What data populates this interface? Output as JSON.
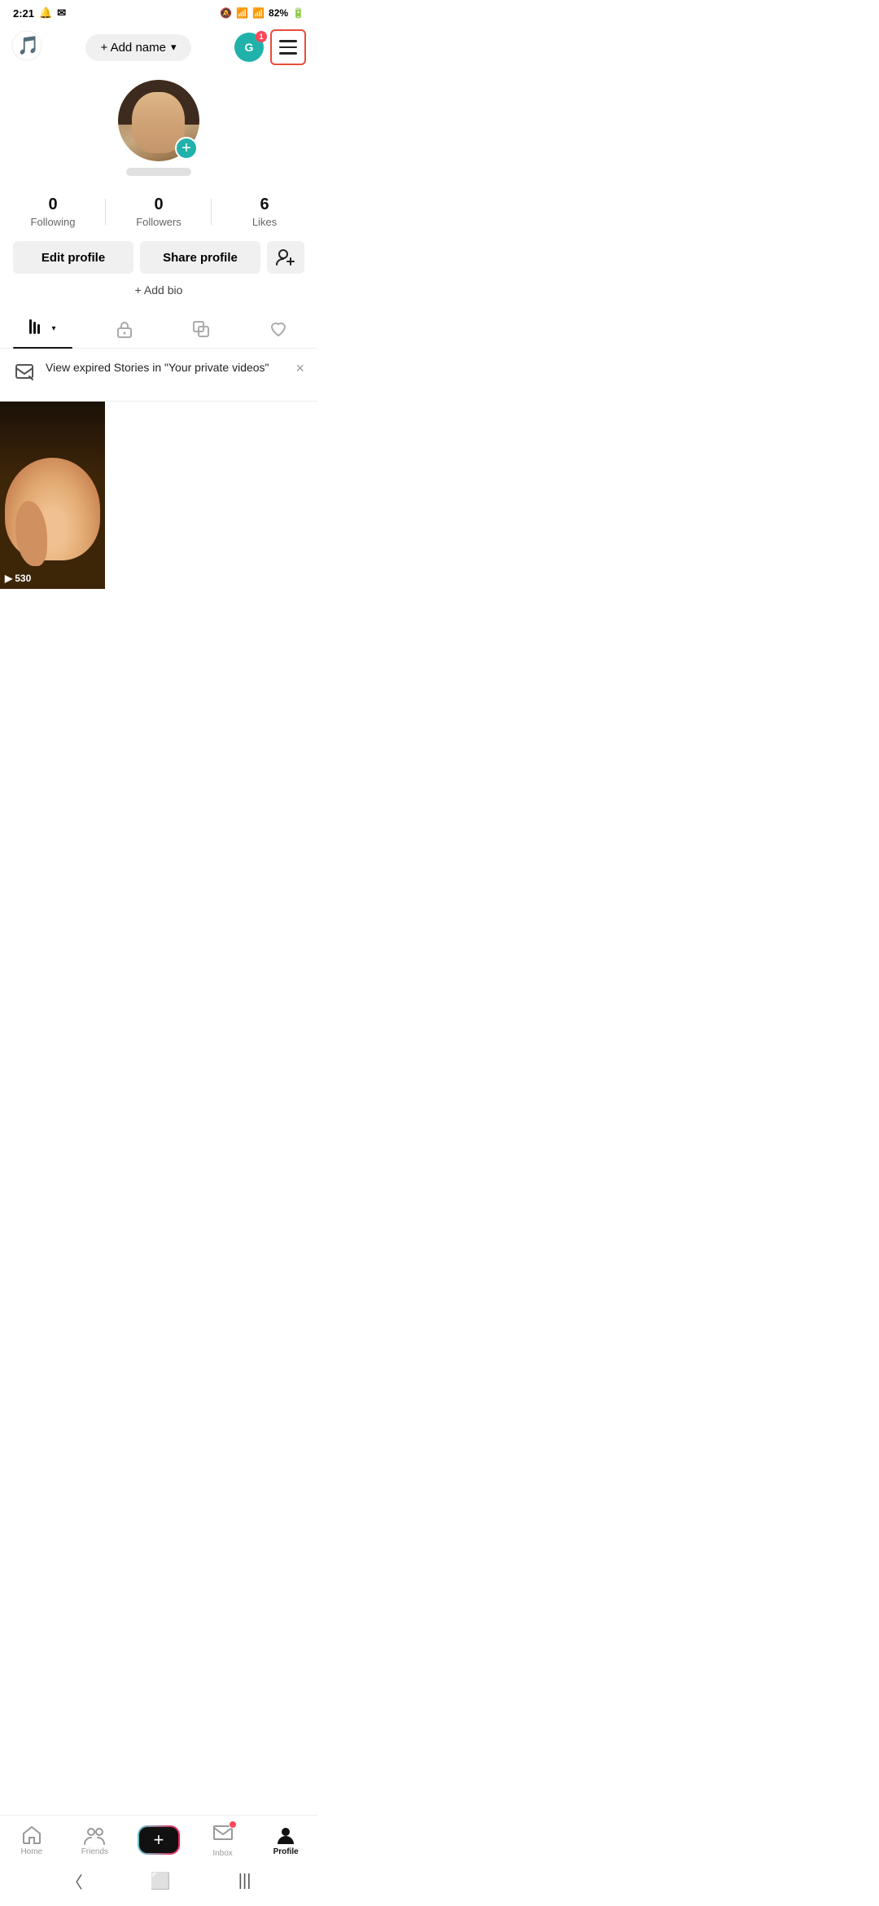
{
  "statusBar": {
    "time": "2:21",
    "battery": "82%"
  },
  "topNav": {
    "addNameLabel": "+ Add name",
    "dropdownArrow": "▾",
    "avatarLetter": "G",
    "notificationCount": "1"
  },
  "profile": {
    "avatarAlt": "Profile photo",
    "addStoryLabel": "+",
    "stats": [
      {
        "value": "0",
        "label": "Following"
      },
      {
        "value": "0",
        "label": "Followers"
      },
      {
        "value": "6",
        "label": "Likes"
      }
    ],
    "editProfileLabel": "Edit profile",
    "shareProfileLabel": "Share profile",
    "addBioLabel": "+ Add bio"
  },
  "tabs": [
    {
      "id": "videos",
      "label": "videos",
      "active": true
    },
    {
      "id": "private",
      "label": "private"
    },
    {
      "id": "reposted",
      "label": "reposted"
    },
    {
      "id": "liked",
      "label": "liked"
    }
  ],
  "notice": {
    "text": "View expired Stories in \"Your private videos\"",
    "closeLabel": "×"
  },
  "videos": [
    {
      "playCount": "530"
    }
  ],
  "bottomNav": [
    {
      "id": "home",
      "label": "Home",
      "active": false
    },
    {
      "id": "friends",
      "label": "Friends",
      "active": false
    },
    {
      "id": "create",
      "label": "",
      "active": false
    },
    {
      "id": "inbox",
      "label": "Inbox",
      "active": false,
      "hasBadge": true
    },
    {
      "id": "profile",
      "label": "Profile",
      "active": true
    }
  ]
}
